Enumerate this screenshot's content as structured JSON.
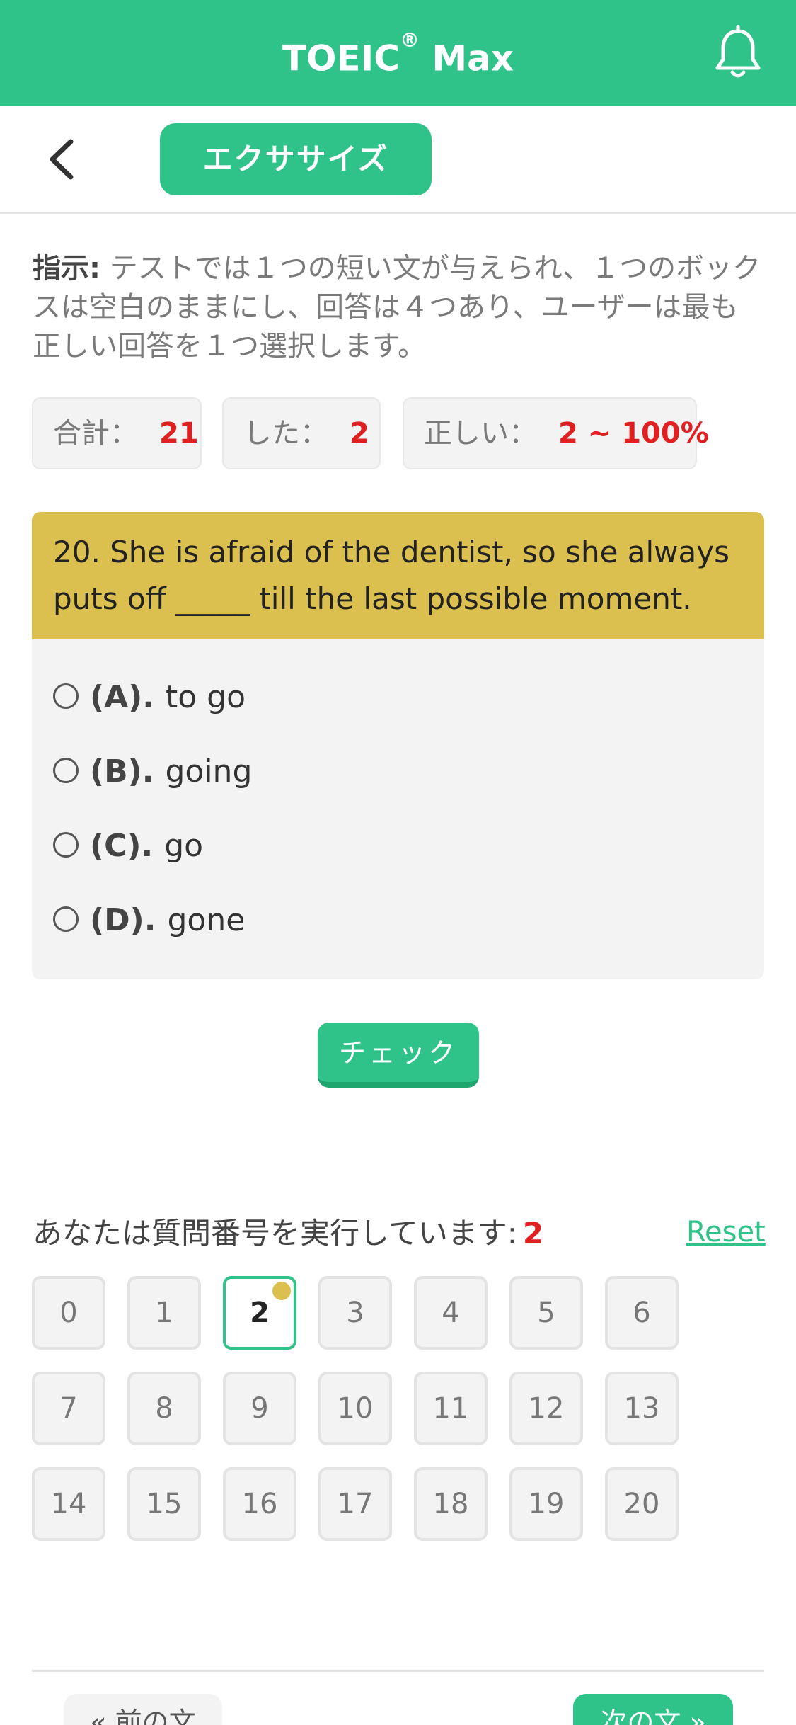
{
  "header": {
    "title": "TOEIC",
    "reg": "®",
    "title_suffix": " Max",
    "bell_icon": "bell-icon"
  },
  "subnav": {
    "back_icon": "chevron-left-icon",
    "tab_label": "エクササイズ"
  },
  "instruction": {
    "label": "指示:",
    "text": " テストでは１つの短い文が与えられ、１つのボックスは空白のままにし、回答は４つあり、ユーザーは最も正しい回答を１つ選択します。"
  },
  "stats": {
    "total_label": "合計：",
    "total_value": "21",
    "done_label": "した：",
    "done_value": "2",
    "correct_label": "正しい：",
    "correct_value": "2 ~ 100%"
  },
  "question": {
    "text": "20. She is afraid of the dentist, so she always puts off _____ till the last possible moment.",
    "options": [
      {
        "key": "(A).",
        "text": "to go"
      },
      {
        "key": "(B).",
        "text": "going"
      },
      {
        "key": "(C).",
        "text": "go"
      },
      {
        "key": "(D).",
        "text": "gone"
      }
    ]
  },
  "check_label": "チェック",
  "progress": {
    "running_label": "あなたは質問番号を実行しています:",
    "current": "2",
    "reset_label": "Reset",
    "numbers": [
      "0",
      "1",
      "2",
      "3",
      "4",
      "5",
      "6",
      "7",
      "8",
      "9",
      "10",
      "11",
      "12",
      "13",
      "14",
      "15",
      "16",
      "17",
      "18",
      "19",
      "20"
    ]
  },
  "nav": {
    "prev_label": "« 前の文",
    "next_label": "次の文 »"
  },
  "colors": {
    "accent": "#2fc389",
    "question_bg": "#dbbf4f",
    "highlight": "#e02020"
  }
}
